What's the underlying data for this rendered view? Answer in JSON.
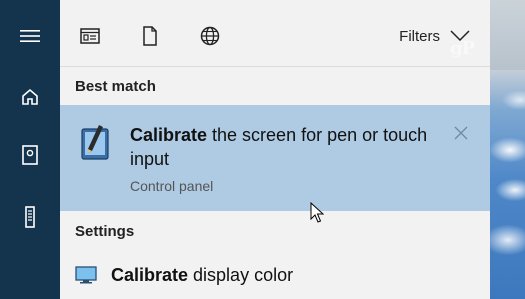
{
  "rail": {
    "icons": [
      "hamburger-icon",
      "home-icon",
      "notebook-icon",
      "tower-icon"
    ]
  },
  "toolbar": {
    "icons": [
      "apps-icon",
      "documents-icon",
      "web-icon"
    ],
    "filters_label": "Filters"
  },
  "best_match": {
    "section_label": "Best match",
    "title_bold": "Calibrate",
    "title_rest": " the screen for pen or touch input",
    "subtitle": "Control panel",
    "highlight_color": "#aecbe3"
  },
  "settings": {
    "section_label": "Settings",
    "items": [
      {
        "bold": "Calibrate",
        "rest": " display color",
        "icon": "monitor-icon"
      }
    ]
  },
  "watermark": "gP",
  "colors": {
    "rail": "#14344d",
    "panel": "#f2f2f2",
    "highlight": "#aecbe3"
  }
}
